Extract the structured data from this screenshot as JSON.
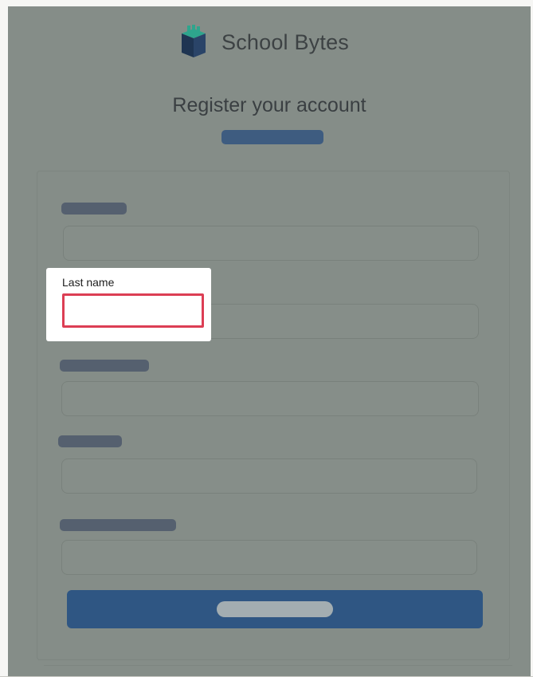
{
  "header": {
    "brand_name": "School Bytes",
    "logo_icon": "book-stack-icon",
    "page_title": "Register your account"
  },
  "form": {
    "fields": [
      {
        "redacted": true
      },
      {
        "label": "Last name",
        "value": "",
        "highlighted": true
      },
      {
        "redacted": true
      },
      {
        "redacted": true
      },
      {
        "redacted": true
      }
    ],
    "submit_redacted": true
  },
  "colors": {
    "overlay": "#858d88",
    "button": "#2f5683",
    "highlight_border": "#dc3e54",
    "logo_teal": "#2ea58d",
    "logo_navy": "#1f3552"
  }
}
